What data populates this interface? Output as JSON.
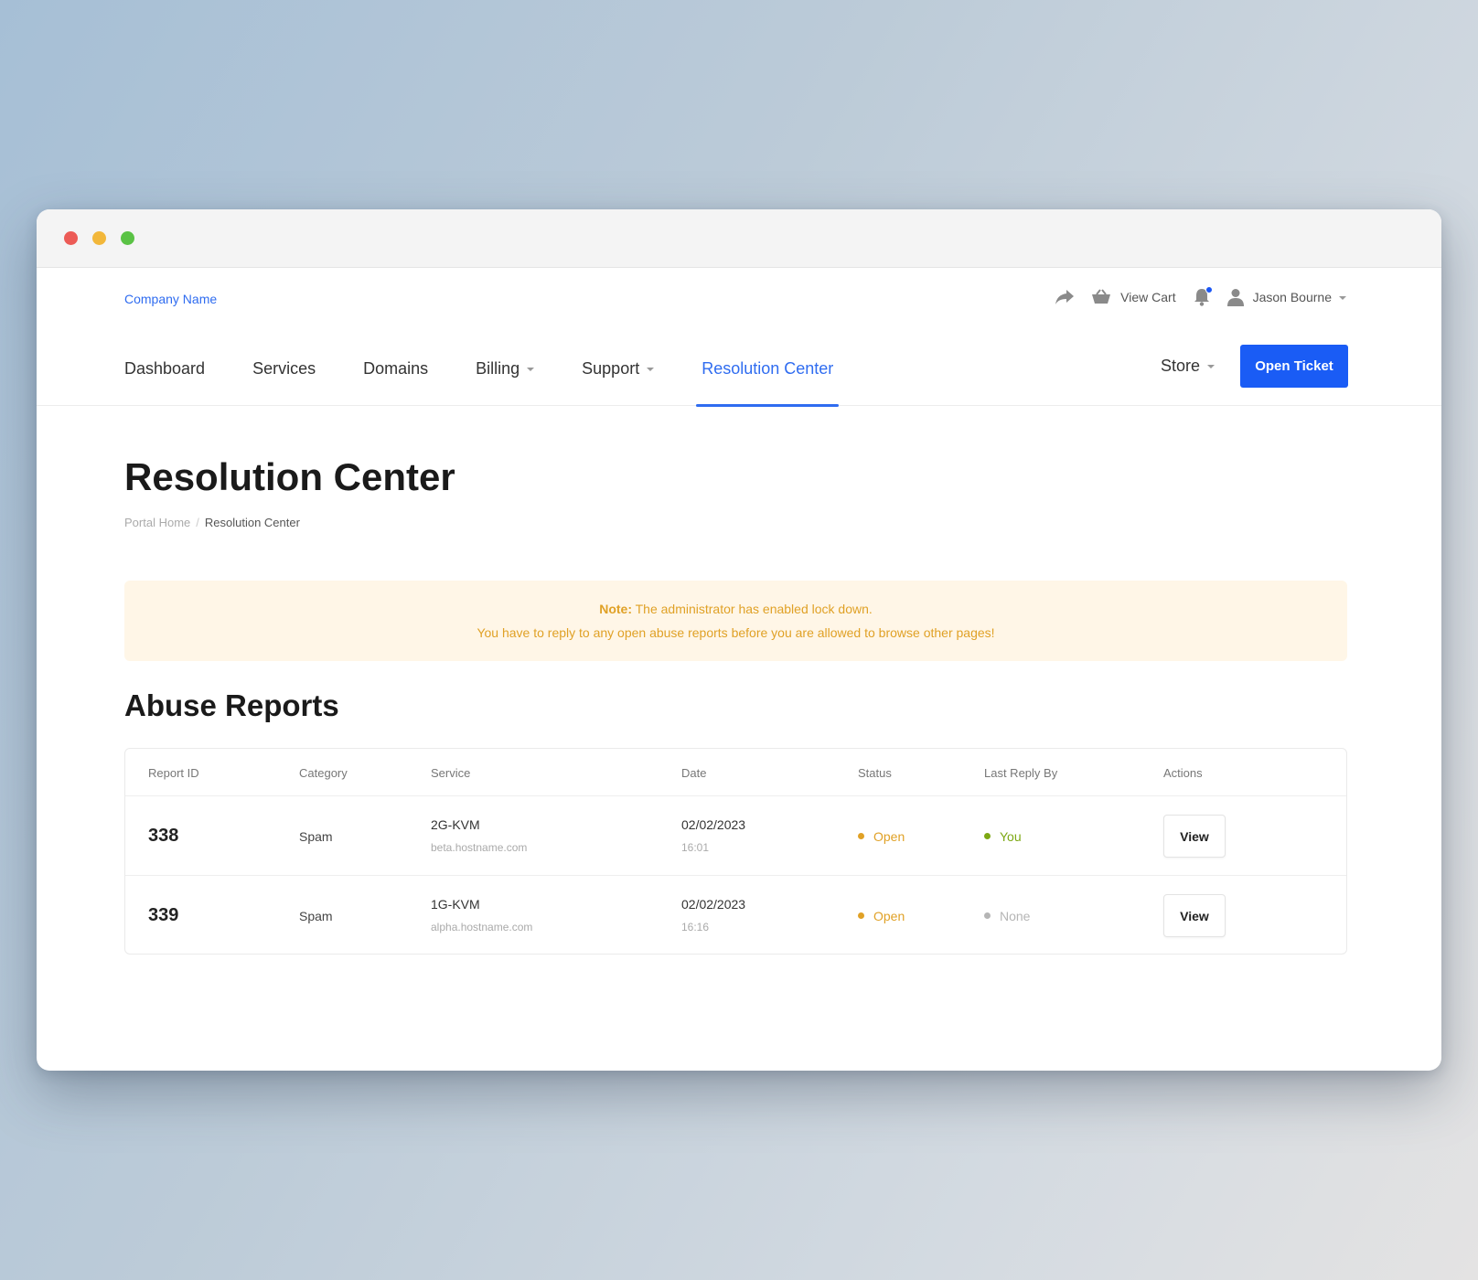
{
  "header": {
    "brand": "Company Name",
    "view_cart_label": "View Cart",
    "user_name": "Jason Bourne",
    "icons": [
      "share-icon",
      "basket-icon",
      "bell-icon",
      "user-icon"
    ]
  },
  "nav": {
    "items": [
      {
        "label": "Dashboard",
        "active": false,
        "dropdown": false
      },
      {
        "label": "Services",
        "active": false,
        "dropdown": false
      },
      {
        "label": "Domains",
        "active": false,
        "dropdown": false
      },
      {
        "label": "Billing",
        "active": false,
        "dropdown": true
      },
      {
        "label": "Support",
        "active": false,
        "dropdown": true
      },
      {
        "label": "Resolution Center",
        "active": true,
        "dropdown": false
      }
    ],
    "store_label": "Store",
    "open_ticket_label": "Open Ticket"
  },
  "page": {
    "title": "Resolution Center",
    "breadcrumb": [
      "Portal Home",
      "Resolution Center"
    ]
  },
  "alert": {
    "note_label": "Note:",
    "line1": "The administrator has enabled lock down.",
    "line2": "You have to reply to any open abuse reports before you are allowed to browse other pages!"
  },
  "reports": {
    "title": "Abuse Reports",
    "columns": [
      "Report ID",
      "Category",
      "Service",
      "Date",
      "Status",
      "Last Reply By",
      "Actions"
    ],
    "rows": [
      {
        "id": "338",
        "category": "Spam",
        "service": "2G-KVM",
        "hostname": "beta.hostname.com",
        "date": "02/02/2023",
        "time": "16:01",
        "status": "Open",
        "last_reply": "You",
        "action": "View"
      },
      {
        "id": "339",
        "category": "Spam",
        "service": "1G-KVM",
        "hostname": "alpha.hostname.com",
        "date": "02/02/2023",
        "time": "16:16",
        "status": "Open",
        "last_reply": "None",
        "action": "View"
      }
    ]
  },
  "colors": {
    "accent": "#1a5cf5",
    "link": "#2f6cf0",
    "warning": "#e0a126",
    "warning_bg": "#fff6e7",
    "success": "#7da814",
    "muted": "#b5b5b5"
  }
}
